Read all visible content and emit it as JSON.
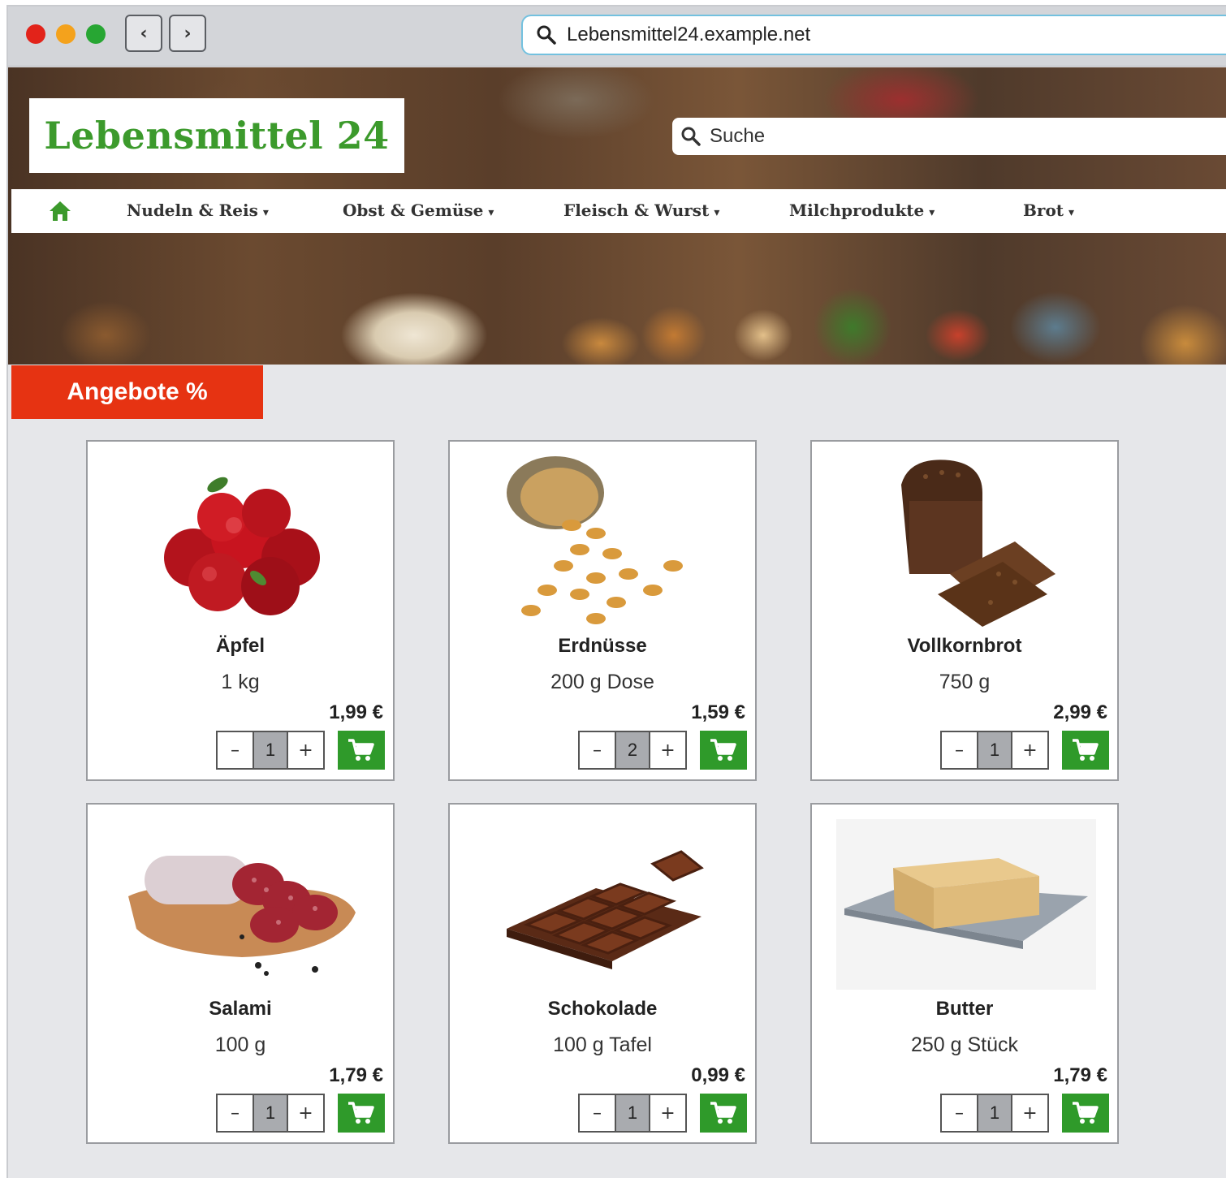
{
  "browser": {
    "url": "Lebensmittel24.example.net"
  },
  "site": {
    "logo": "Lebensmittel 24",
    "search_placeholder": "Suche",
    "accent_color": "#3c9a2c",
    "offer_color": "#e63312"
  },
  "menu": {
    "items": [
      {
        "label": "Nudeln & Reis"
      },
      {
        "label": "Obst & Gemüse"
      },
      {
        "label": "Fleisch & Wurst"
      },
      {
        "label": "Milchprodukte"
      },
      {
        "label": "Brot"
      }
    ],
    "caret": "▾"
  },
  "offers": {
    "label": "Angebote %"
  },
  "products": [
    {
      "name": "Äpfel",
      "qty": "1 kg",
      "price": "1,99 €",
      "count": "1",
      "icon": "apples-image"
    },
    {
      "name": "Erdnüsse",
      "qty": "200 g Dose",
      "price": "1,59 €",
      "count": "2",
      "icon": "peanuts-image"
    },
    {
      "name": "Vollkornbrot",
      "qty": "750 g",
      "price": "2,99 €",
      "count": "1",
      "icon": "bread-image"
    },
    {
      "name": "Salami",
      "qty": "100 g",
      "price": "1,79 €",
      "count": "1",
      "icon": "salami-image"
    },
    {
      "name": "Schokolade",
      "qty": "100 g Tafel",
      "price": "0,99 €",
      "count": "1",
      "icon": "chocolate-image"
    },
    {
      "name": "Butter",
      "qty": "250 g Stück",
      "price": "1,79 €",
      "count": "1",
      "icon": "butter-image"
    }
  ],
  "stepper": {
    "minus": "–",
    "plus": "+"
  }
}
